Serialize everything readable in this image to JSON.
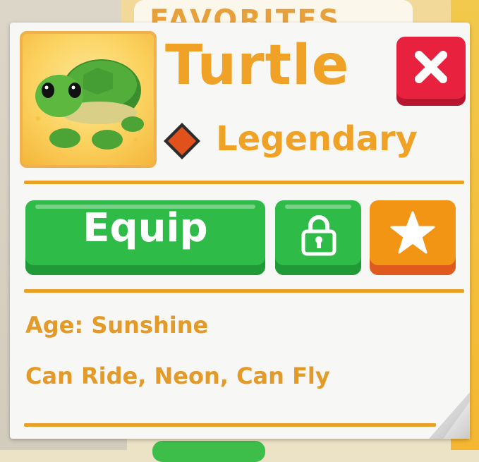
{
  "background": {
    "favorites_label": "FAVORITES"
  },
  "pet": {
    "name": "Turtle",
    "rarity": "Legendary",
    "rarity_color": "#e0511c",
    "age_line": "Age: Sunshine",
    "traits_line": "Can Ride, Neon, Can Fly"
  },
  "buttons": {
    "equip_label": "Equip",
    "lock_icon": "lock-icon",
    "favorite_icon": "star-icon",
    "close_icon": "close-icon"
  },
  "colors": {
    "accent": "#efa226",
    "green": "#2fbb47",
    "orange": "#f29414",
    "red": "#e8213f"
  }
}
